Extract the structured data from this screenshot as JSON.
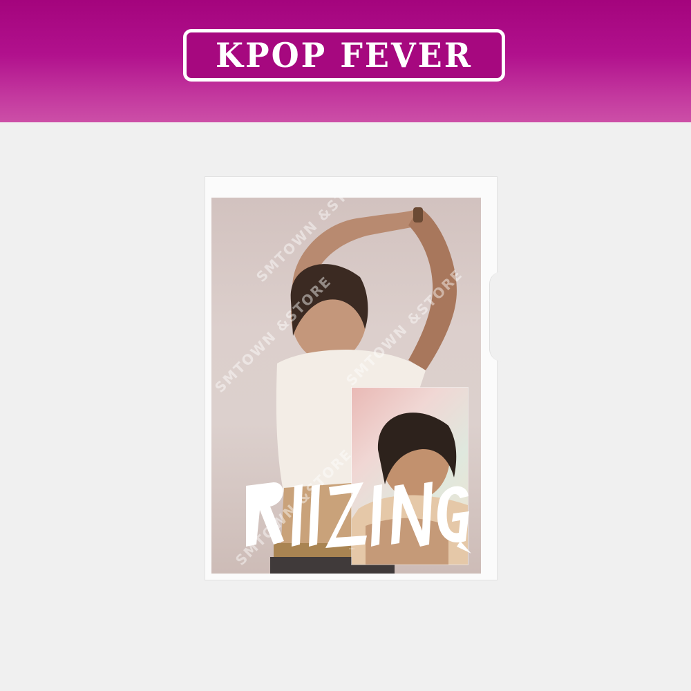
{
  "banner": {
    "logo_text": "KPOP FEVER",
    "background_color": "#b1118d",
    "logo_border_color": "#ffffff"
  },
  "product": {
    "artwork_logo_text": "RIIZING",
    "watermark_text": "SMTOWN &STORE",
    "background_color": "#f0f0f0"
  }
}
